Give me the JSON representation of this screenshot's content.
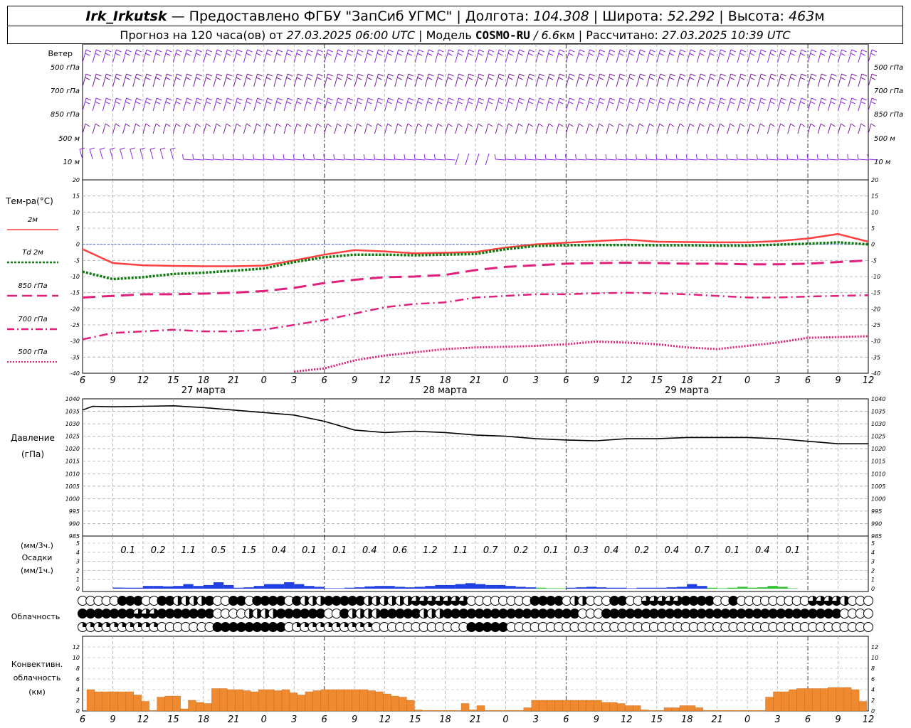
{
  "header": {
    "station": "Irk_Irkutsk",
    "provider": "— Предоставлено ФГБУ \"ЗапСиб УГМС\"",
    "lon_label": "Долгота:",
    "lon": "104.308",
    "lat_label": "Широта:",
    "lat": "52.292",
    "alt_label": "Высота:",
    "alt": "463",
    "alt_unit": "м",
    "forecast_label": "Прогноз на 120 часа(ов) от",
    "forecast_from": "27.03.2025 06:00 UTC",
    "model_label": "Модель",
    "model_name": "COSMO-RU",
    "model_sep": "/",
    "model_res": "6.6",
    "model_res_unit": "км",
    "calc_label": "Рассчитано:",
    "calc_time": "27.03.2025 10:39 UTC"
  },
  "labels": {
    "wind_title": "Ветер",
    "wind_levels": [
      "500 гПа",
      "700 гПа",
      "850 гПа",
      "500 м",
      "10 м"
    ],
    "temp_title": "Тем-ра(°C)",
    "legend": [
      {
        "text": "2м",
        "color": "#ff4040",
        "dash": "solid"
      },
      {
        "text": "Td 2м",
        "color": "#0a7a0a",
        "dash": "dot"
      },
      {
        "text": "850 гПа",
        "color": "#e0207a",
        "dash": "dash"
      },
      {
        "text": "700 гПа",
        "color": "#e0207a",
        "dash": "dashdot"
      },
      {
        "text": "500 гПа",
        "color": "#e0207a",
        "dash": "fine"
      }
    ],
    "pressure_title": "Давление",
    "pressure_unit": "(гПа)",
    "precip_unit3": "(мм/3ч.)",
    "precip_title": "Осадки",
    "precip_unit1": "(мм/1ч.)",
    "cloud_title": "Облачность",
    "conv_title1": "Конвективн.",
    "conv_title2": "облачность",
    "conv_unit": "(км)"
  },
  "chart_data": {
    "x_hours": [
      6,
      9,
      12,
      15,
      18,
      21,
      0,
      3,
      6,
      9,
      12,
      15,
      18,
      21,
      0,
      3,
      6,
      9,
      12,
      15,
      18,
      21,
      0,
      3,
      6,
      9,
      12
    ],
    "day_labels": [
      "27 марта",
      "28 марта",
      "29 марта"
    ],
    "temperature": {
      "type": "line",
      "ylim": [
        -40,
        20
      ],
      "y_ticks": [
        20,
        15,
        10,
        5,
        0,
        -5,
        -10,
        -15,
        -20,
        -25,
        -30,
        -35,
        -40
      ],
      "series": [
        {
          "name": "2м",
          "color": "#ff4040",
          "x": [
            0,
            3,
            6,
            9,
            12,
            15,
            18,
            21,
            24,
            27,
            30,
            33,
            36,
            39,
            42,
            45,
            48,
            51,
            54,
            57,
            60,
            63,
            66,
            69,
            72,
            75,
            78
          ],
          "values": [
            -1.5,
            -5.8,
            -6.5,
            -6.7,
            -6.8,
            -6.8,
            -6.6,
            -5.0,
            -3.2,
            -1.8,
            -2.2,
            -2.8,
            -2.6,
            -2.4,
            -1.0,
            0.0,
            0.5,
            1.0,
            1.5,
            0.8,
            0.7,
            0.6,
            0.6,
            1.0,
            1.8,
            3.2,
            0.8
          ]
        },
        {
          "name": "Td 2м",
          "color": "#0a7a0a",
          "x": [
            0,
            3,
            6,
            9,
            12,
            15,
            18,
            21,
            24,
            27,
            30,
            33,
            36,
            39,
            42,
            45,
            48,
            51,
            54,
            57,
            60,
            63,
            66,
            69,
            72,
            75,
            78
          ],
          "values": [
            -8.5,
            -10.8,
            -10.2,
            -9.2,
            -8.8,
            -8.2,
            -7.5,
            -5.5,
            -4.0,
            -3.2,
            -3.2,
            -3.4,
            -3.2,
            -3.0,
            -1.5,
            -0.5,
            -0.3,
            -0.2,
            -0.2,
            -0.3,
            -0.3,
            -0.4,
            -0.4,
            -0.1,
            0.2,
            0.6,
            0.0
          ]
        },
        {
          "name": "850 гПа",
          "color": "#e0207a",
          "x": [
            0,
            3,
            6,
            9,
            12,
            15,
            18,
            21,
            24,
            27,
            30,
            33,
            36,
            39,
            42,
            45,
            48,
            51,
            54,
            57,
            60,
            63,
            66,
            69,
            72,
            75,
            78
          ],
          "values": [
            -16.5,
            -16.0,
            -15.5,
            -15.5,
            -15.3,
            -15.0,
            -14.5,
            -13.5,
            -12.0,
            -11.0,
            -10.2,
            -10.0,
            -9.5,
            -8.0,
            -7.0,
            -6.5,
            -6.0,
            -5.8,
            -5.7,
            -5.8,
            -6.0,
            -6.0,
            -6.2,
            -6.2,
            -6.0,
            -5.5,
            -5.0
          ]
        },
        {
          "name": "700 гПа",
          "color": "#e0207a",
          "x": [
            0,
            3,
            6,
            9,
            12,
            15,
            18,
            21,
            24,
            27,
            30,
            33,
            36,
            39,
            42,
            45,
            48,
            51,
            54,
            57,
            60,
            63,
            66,
            69,
            72,
            75,
            78
          ],
          "values": [
            -29.5,
            -27.5,
            -27.0,
            -26.5,
            -27.0,
            -27.0,
            -26.5,
            -25.0,
            -23.5,
            -21.5,
            -19.5,
            -18.5,
            -18.0,
            -16.5,
            -16.0,
            -15.5,
            -15.5,
            -15.2,
            -15.0,
            -15.2,
            -15.5,
            -16.0,
            -16.5,
            -16.5,
            -16.2,
            -16.0,
            -15.8
          ]
        },
        {
          "name": "500 гПа",
          "color": "#e0207a",
          "x": [
            21,
            24,
            27,
            30,
            33,
            36,
            39,
            42,
            45,
            48,
            51,
            54,
            57,
            60,
            63,
            66,
            69,
            72,
            75,
            78
          ],
          "values": [
            -39.5,
            -38.5,
            -36.0,
            -34.5,
            -33.5,
            -32.5,
            -32.0,
            -31.8,
            -31.5,
            -31.0,
            -30.2,
            -30.5,
            -31.0,
            -32.0,
            -32.5,
            -31.5,
            -30.5,
            -29.0,
            -28.8,
            -28.5
          ]
        }
      ]
    },
    "pressure": {
      "type": "line",
      "ylim": [
        985,
        1040
      ],
      "y_ticks": [
        1040,
        1035,
        1030,
        1025,
        1020,
        1015,
        1010,
        1005,
        1000,
        995,
        990,
        985
      ],
      "x": [
        0,
        1,
        3,
        6,
        9,
        12,
        15,
        18,
        21,
        24,
        27,
        30,
        33,
        36,
        39,
        42,
        45,
        48,
        51,
        54,
        57,
        60,
        63,
        66,
        69,
        72,
        75,
        78
      ],
      "values": [
        1035.5,
        1037.0,
        1036.8,
        1037.0,
        1037.2,
        1036.5,
        1035.5,
        1034.5,
        1033.5,
        1031.0,
        1027.5,
        1026.5,
        1027.0,
        1026.5,
        1025.5,
        1025.0,
        1024.0,
        1023.5,
        1023.2,
        1024.0,
        1024.0,
        1024.5,
        1024.5,
        1024.5,
        1024.0,
        1023.0,
        1022.0,
        1022.0
      ]
    },
    "precip": {
      "type": "bar",
      "ylim": [
        0,
        5
      ],
      "y_ticks": [
        5,
        4,
        3,
        2,
        1,
        0
      ],
      "totals_3h": [
        "0.1",
        "0.2",
        "1.1",
        "0.5",
        "1.5",
        "0.4",
        "0.1",
        "0.1",
        "0.4",
        "0.6",
        "1.2",
        "1.1",
        "0.7",
        "0.2",
        "0.1",
        "0.3",
        "0.4",
        "0.2",
        "0.4",
        "0.7",
        "0.1",
        "0.4",
        "0.1"
      ],
      "totals_start_hour": 9,
      "hourly": [
        {
          "h": 10,
          "v": 0.12,
          "c": "#2040e0"
        },
        {
          "h": 11,
          "v": 0.1,
          "c": "#2040e0"
        },
        {
          "h": 12,
          "v": 0.1,
          "c": "#2040e0"
        },
        {
          "h": 13,
          "v": 0.3,
          "c": "#2040e0"
        },
        {
          "h": 14,
          "v": 0.3,
          "c": "#2040e0"
        },
        {
          "h": 15,
          "v": 0.25,
          "c": "#2040e0"
        },
        {
          "h": 16,
          "v": 0.3,
          "c": "#2040e0"
        },
        {
          "h": 17,
          "v": 0.5,
          "c": "#2040e0"
        },
        {
          "h": 18,
          "v": 0.3,
          "c": "#2040e0"
        },
        {
          "h": 19,
          "v": 0.4,
          "c": "#2040e0"
        },
        {
          "h": 20,
          "v": 0.7,
          "c": "#2040e0"
        },
        {
          "h": 21,
          "v": 0.4,
          "c": "#2040e0"
        },
        {
          "h": 22,
          "v": 0.1,
          "c": "#2040e0"
        },
        {
          "h": 23,
          "v": 0.15,
          "c": "#2040e0"
        },
        {
          "h": 24,
          "v": 0.3,
          "c": "#2040e0"
        },
        {
          "h": 25,
          "v": 0.5,
          "c": "#2040e0"
        },
        {
          "h": 26,
          "v": 0.5,
          "c": "#2040e0"
        },
        {
          "h": 27,
          "v": 0.7,
          "c": "#2040e0"
        },
        {
          "h": 28,
          "v": 0.5,
          "c": "#2040e0"
        },
        {
          "h": 29,
          "v": 0.3,
          "c": "#2040e0"
        },
        {
          "h": 30,
          "v": 0.2,
          "c": "#2040e0"
        },
        {
          "h": 31,
          "v": 0.05,
          "c": "#2040e0"
        },
        {
          "h": 32,
          "v": 0.05,
          "c": "#2040e0"
        },
        {
          "h": 33,
          "v": 0.1,
          "c": "#2040e0"
        },
        {
          "h": 34,
          "v": 0.15,
          "c": "#2040e0"
        },
        {
          "h": 35,
          "v": 0.25,
          "c": "#2040e0"
        },
        {
          "h": 36,
          "v": 0.3,
          "c": "#2040e0"
        },
        {
          "h": 37,
          "v": 0.3,
          "c": "#2040e0"
        },
        {
          "h": 38,
          "v": 0.2,
          "c": "#2040e0"
        },
        {
          "h": 39,
          "v": 0.15,
          "c": "#2040e0"
        },
        {
          "h": 40,
          "v": 0.2,
          "c": "#2040e0"
        },
        {
          "h": 41,
          "v": 0.3,
          "c": "#2040e0"
        },
        {
          "h": 42,
          "v": 0.4,
          "c": "#2040e0"
        },
        {
          "h": 43,
          "v": 0.4,
          "c": "#2040e0"
        },
        {
          "h": 44,
          "v": 0.5,
          "c": "#2040e0"
        },
        {
          "h": 45,
          "v": 0.6,
          "c": "#2040e0"
        },
        {
          "h": 46,
          "v": 0.5,
          "c": "#2040e0"
        },
        {
          "h": 47,
          "v": 0.4,
          "c": "#2040e0"
        },
        {
          "h": 48,
          "v": 0.4,
          "c": "#2040e0"
        },
        {
          "h": 49,
          "v": 0.3,
          "c": "#2040e0"
        },
        {
          "h": 50,
          "v": 0.2,
          "c": "#2040e0"
        },
        {
          "h": 51,
          "v": 0.15,
          "c": "#2040e0"
        },
        {
          "h": 52,
          "v": 0.1,
          "c": "#30c030"
        },
        {
          "h": 53,
          "v": 0.05,
          "c": "#30c030"
        },
        {
          "h": 54,
          "v": 0.05,
          "c": "#30c030"
        },
        {
          "h": 55,
          "v": 0.1,
          "c": "#2040e0"
        },
        {
          "h": 56,
          "v": 0.15,
          "c": "#2040e0"
        },
        {
          "h": 57,
          "v": 0.2,
          "c": "#2040e0"
        },
        {
          "h": 58,
          "v": 0.15,
          "c": "#2040e0"
        },
        {
          "h": 59,
          "v": 0.1,
          "c": "#2040e0"
        },
        {
          "h": 60,
          "v": 0.1,
          "c": "#2040e0"
        },
        {
          "h": 61,
          "v": 0.05,
          "c": "#2040e0"
        },
        {
          "h": 62,
          "v": 0.1,
          "c": "#2040e0"
        },
        {
          "h": 63,
          "v": 0.1,
          "c": "#2040e0"
        },
        {
          "h": 64,
          "v": 0.1,
          "c": "#2040e0"
        },
        {
          "h": 65,
          "v": 0.15,
          "c": "#2040e0"
        },
        {
          "h": 66,
          "v": 0.2,
          "c": "#2040e0"
        },
        {
          "h": 67,
          "v": 0.5,
          "c": "#2040e0"
        },
        {
          "h": 68,
          "v": 0.3,
          "c": "#2040e0"
        },
        {
          "h": 69,
          "v": 0.1,
          "c": "#30c030"
        },
        {
          "h": 70,
          "v": 0.05,
          "c": "#30c030"
        },
        {
          "h": 71,
          "v": 0.1,
          "c": "#30c030"
        },
        {
          "h": 72,
          "v": 0.2,
          "c": "#30c030"
        },
        {
          "h": 73,
          "v": 0.1,
          "c": "#30c030"
        },
        {
          "h": 74,
          "v": 0.15,
          "c": "#30c030"
        },
        {
          "h": 75,
          "v": 0.3,
          "c": "#30c030"
        },
        {
          "h": 76,
          "v": 0.2,
          "c": "#30c030"
        },
        {
          "h": 77,
          "v": 0.05,
          "c": "#30c030"
        }
      ]
    },
    "clouds": {
      "rows": [
        "0000011100112222100110111101222111112222223333333000000001111022000110033333111100100000000033332000",
        "1111111333111111100002222111111001222211111222111111111111111110001111111111111111111111111111110000",
        "4444444444000000011111111104444444444000000000000111110000000000000000000000000000000000000000000000"
      ]
    },
    "convective": {
      "type": "bar",
      "ylim": [
        0,
        14
      ],
      "y_ticks": [
        12,
        10,
        8,
        6,
        4,
        2,
        0
      ],
      "color": "#f08a30",
      "values": [
        4.0,
        3.6,
        3.6,
        3.6,
        3.6,
        3.6,
        3.0,
        1.8,
        0.1,
        2.6,
        2.8,
        2.8,
        0.4,
        2.0,
        1.6,
        1.4,
        4.2,
        4.2,
        4.0,
        4.0,
        3.8,
        3.6,
        4.0,
        4.0,
        3.8,
        4.0,
        3.4,
        3.0,
        3.6,
        3.8,
        4.0,
        4.0,
        4.0,
        4.0,
        4.0,
        4.0,
        3.8,
        3.6,
        3.2,
        2.8,
        2.6,
        2.0,
        0.2,
        0.1,
        0.1,
        0.1,
        0.1,
        0.1,
        1.4,
        0.2,
        1.0,
        0.1,
        0.1,
        0.1,
        0.1,
        0.1,
        0.6,
        2.0,
        2.0,
        2.0,
        2.0,
        2.0,
        2.0,
        2.0,
        2.0,
        2.0,
        1.6,
        1.6,
        1.4,
        1.0,
        1.0,
        0.2,
        0.1,
        0.1,
        0.6,
        0.6,
        1.0,
        1.0,
        0.6,
        0.1,
        0.1,
        0.1,
        0.1,
        0.1,
        0.1,
        0.1,
        0.1,
        2.6,
        3.6,
        3.6,
        4.0,
        4.2,
        4.2,
        4.2,
        4.2,
        4.4,
        4.4,
        4.4,
        4.0,
        1.8
      ]
    },
    "wind": {
      "colors": [
        "#8a2be2",
        "#7a1fa0"
      ]
    }
  }
}
